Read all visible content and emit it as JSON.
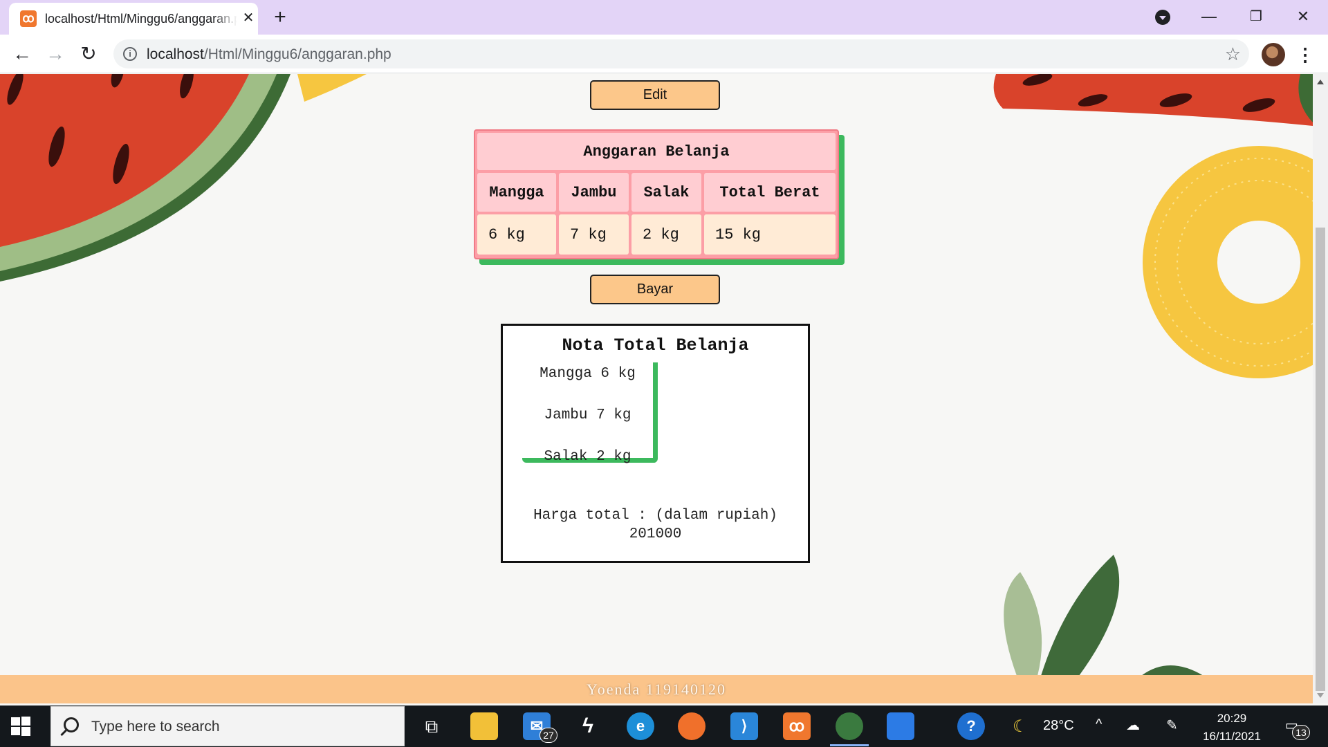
{
  "browser": {
    "tab_title": "localhost/Html/Minggu6/anggaran.php",
    "tab_favicon": "xampp-icon",
    "new_tab_label": "+",
    "url_host": "localhost",
    "url_path": "/Html/Minggu6/anggaran.php"
  },
  "page": {
    "edit_button": "Edit",
    "pay_button": "Bayar",
    "budget_table": {
      "title": "Anggaran Belanja",
      "headers": [
        "Mangga",
        "Jambu",
        "Salak",
        "Total Berat"
      ],
      "values": [
        "6 kg",
        "7 kg",
        "2 kg",
        "15 kg"
      ]
    },
    "receipt": {
      "title": "Nota Total Belanja",
      "items": [
        "Mangga 6 kg",
        "Jambu 7 kg",
        "Salak 2 kg"
      ],
      "total_label": "Harga total : (dalam rupiah)",
      "total_value": "201000"
    },
    "footer": "Yoenda 119140120"
  },
  "taskbar": {
    "search_placeholder": "Type here to search",
    "mail_badge": "27",
    "weather_temp": "28°C",
    "time": "20:29",
    "date": "16/11/2021",
    "notification_badge": "13"
  },
  "colors": {
    "accent_green": "#3cb95d",
    "button_orange": "#fcc78a",
    "table_pink": "#fc9ea6",
    "footer_orange": "#fbc48a"
  }
}
